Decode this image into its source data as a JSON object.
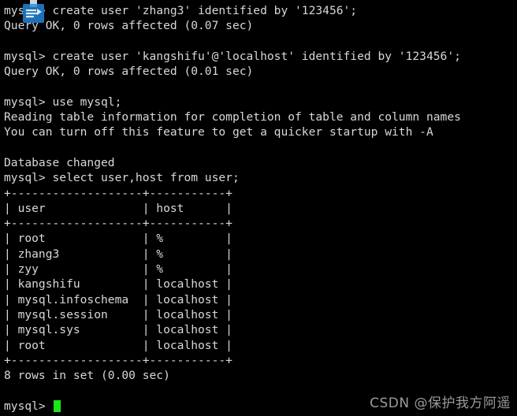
{
  "terminal": {
    "background_color": "#000000",
    "text_color": "#d8d8d8",
    "cursor_color": "#19e619",
    "lines": [
      "mysql> create user 'zhang3' identified by '123456';",
      "Query OK, 0 rows affected (0.07 sec)",
      "",
      "mysql> create user 'kangshifu'@'localhost' identified by '123456';",
      "Query OK, 0 rows affected (0.01 sec)",
      "",
      "mysql> use mysql;",
      "Reading table information for completion of table and column names",
      "You can turn off this feature to get a quicker startup with -A",
      "",
      "Database changed",
      "mysql> select user,host from user;",
      "+-------------------+-----------+",
      "| user              | host      |",
      "+-------------------+-----------+",
      "| root              | %         |",
      "| zhang3            | %         |",
      "| zyy               | %         |",
      "| kangshifu         | localhost |",
      "| mysql.infoschema  | localhost |",
      "| mysql.session     | localhost |",
      "| mysql.sys         | localhost |",
      "| root              | localhost |",
      "+-------------------+-----------+",
      "8 rows in set (0.00 sec)",
      ""
    ],
    "prompt": "mysql> ",
    "cursor_visible": true
  },
  "query_result": {
    "columns": [
      "user",
      "host"
    ],
    "rows": [
      [
        "root",
        "%"
      ],
      [
        "zhang3",
        "%"
      ],
      [
        "zyy",
        "%"
      ],
      [
        "kangshifu",
        "localhost"
      ],
      [
        "mysql.infoschema",
        "localhost"
      ],
      [
        "mysql.session",
        "localhost"
      ],
      [
        "mysql.sys",
        "localhost"
      ],
      [
        "root",
        "localhost"
      ]
    ],
    "row_count_text": "8 rows in set (0.00 sec)"
  },
  "overlay": {
    "app_icon_name": "sql-app-icon",
    "app_icon_color": "#1b72b8",
    "app_icon_tab_color": "#c9d6e0"
  },
  "watermark": {
    "text": "CSDN @保护我方阿遥",
    "color": "#9a9a9a"
  }
}
